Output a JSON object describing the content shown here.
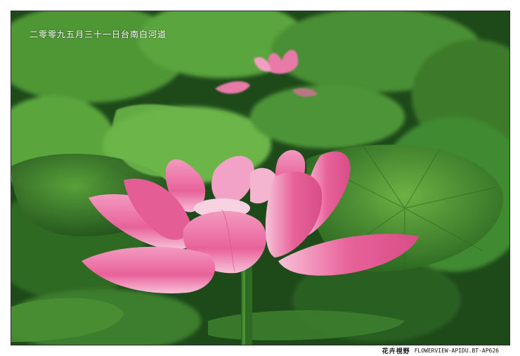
{
  "photo": {
    "caption": "二零零九五月三十一日台南白河道",
    "subject_icon": "lotus-flower-icon",
    "colors": {
      "petal": "#e8629a",
      "petal_light": "#f7c2d8",
      "leaf": "#3f8a31",
      "leaf_dark": "#1e4a1a"
    }
  },
  "footer": {
    "brand": "花卉視野",
    "site": "FLOWERVIEW-APIDU.BT-AP626"
  }
}
